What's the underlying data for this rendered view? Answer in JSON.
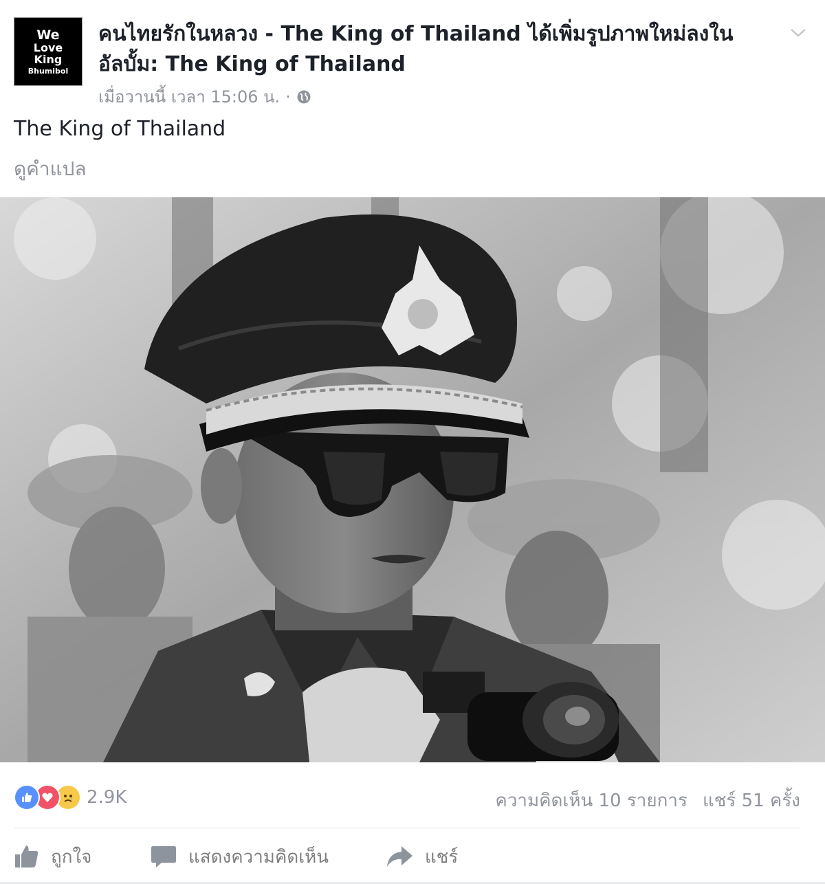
{
  "post": {
    "avatar": {
      "line1": "We",
      "line2": "Love",
      "line3": "King",
      "line4": "Bhumibol"
    },
    "header": {
      "page_name": "คนไทยรักในหลวง - The King of Thailand",
      "action_text": " ได้เพิ่มรูปภาพใหม่ลงในอัลบั้ม: ",
      "album_name": "The King of Thailand"
    },
    "meta": {
      "timestamp": "เมื่อวานนี้ เวลา 15:06 น.",
      "separator": "·",
      "privacy_icon": "globe-icon"
    },
    "caption": "The King of Thailand",
    "translate_link": "ดูคำแปล",
    "reactions": {
      "icons": [
        "like-reaction-icon",
        "love-reaction-icon",
        "sad-reaction-icon"
      ],
      "count": "2.9K"
    },
    "stats": {
      "comments": "ความคิดเห็น 10 รายการ",
      "shares": "แชร์ 51 ครั้ง"
    },
    "actions": {
      "like": "ถูกใจ",
      "comment": "แสดงความคิดเห็น",
      "share": "แชร์"
    },
    "colors": {
      "like_blue": "#5890ff",
      "love_red": "#f25268",
      "sad_yellow": "#f7c94a",
      "meta_gray": "#90949c"
    }
  }
}
